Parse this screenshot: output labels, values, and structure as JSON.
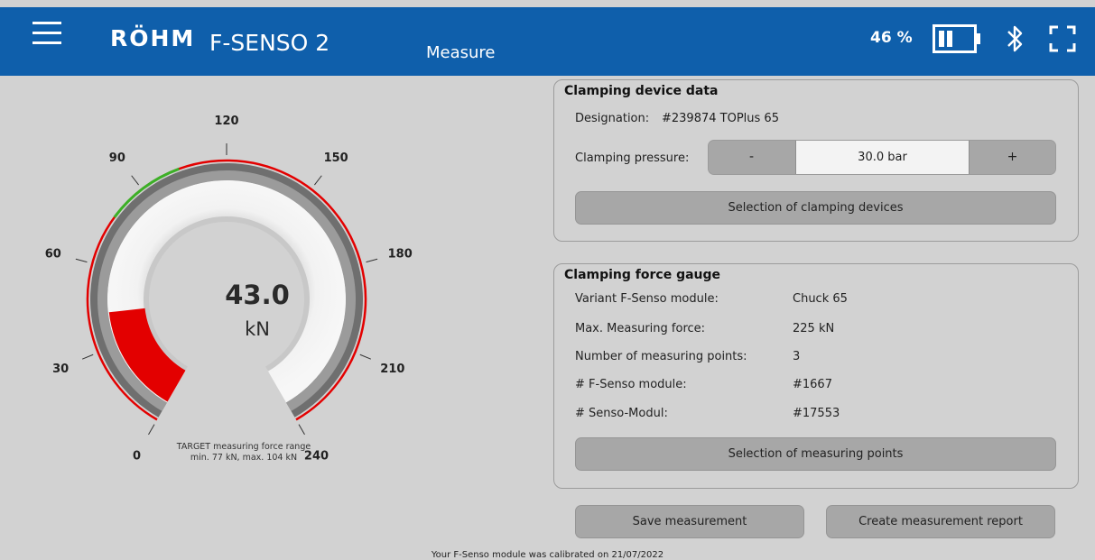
{
  "header": {
    "brand": "RÖHM",
    "product": "F-SENSO 2",
    "page_title": "Measure",
    "battery_text": "46 %",
    "battery_level": 0.46,
    "icons": [
      "menu-icon",
      "battery-icon",
      "bluetooth-icon",
      "fullscreen-icon"
    ],
    "bar_color": "#0f5fab"
  },
  "gauge": {
    "value": "43.0",
    "unit": "kN",
    "value_number": 43.0,
    "min": 0,
    "max": 240,
    "tick_labels": [
      "0",
      "30",
      "60",
      "90",
      "120",
      "150",
      "180",
      "210",
      "240"
    ],
    "target_line1": "TARGET measuring force range",
    "target_line2": "min. 77 kN, max. 104 kN",
    "target_min": 77,
    "target_max": 104,
    "fill_color": "#e30000",
    "target_color": "#3cb027",
    "outer_arc_color": "#e30000"
  },
  "device_panel": {
    "title": "Clamping device data",
    "designation_label": "Designation:",
    "designation_value": "#239874 TOPlus 65",
    "pressure_label": "Clamping pressure:",
    "minus_label": "-",
    "pressure_value": "30.0 bar",
    "plus_label": "+",
    "select_devices": "Selection of clamping devices"
  },
  "gauge_panel": {
    "title": "Clamping force gauge",
    "rows": [
      {
        "label": "Variant F-Senso module:",
        "value": "Chuck 65"
      },
      {
        "label": "Max. Measuring force:",
        "value": "225 kN"
      },
      {
        "label": "Number of measuring points:",
        "value": "3"
      },
      {
        "label": "# F-Senso module:",
        "value": "#1667"
      },
      {
        "label": "# Senso-Modul:",
        "value": "#17553"
      }
    ],
    "select_points": "Selection of measuring points"
  },
  "actions": {
    "save": "Save measurement",
    "report": "Create measurement report"
  },
  "footer": {
    "calibration": "Your F-Senso module was calibrated on 21/07/2022"
  }
}
